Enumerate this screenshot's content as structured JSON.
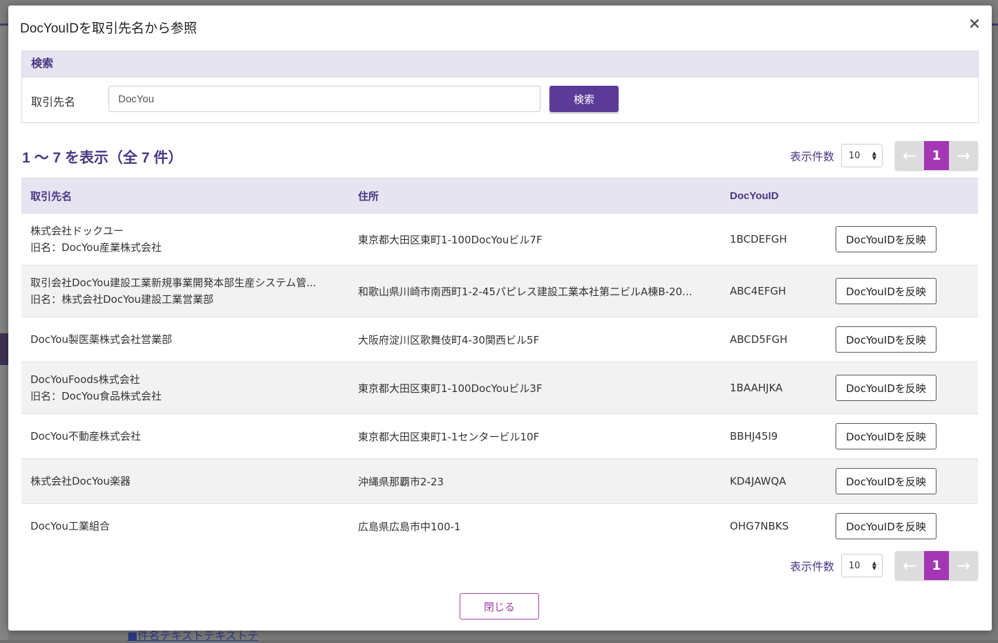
{
  "modal": {
    "title": "DocYouIDを取引先名から参照",
    "close_icon": "×"
  },
  "search": {
    "heading": "検索",
    "label": "取引先名",
    "value": "DocYou",
    "button": "検索"
  },
  "results": {
    "count_text": "1 〜 7 を表示（全 7 件）",
    "per_page_label": "表示件数",
    "per_page_value": "10",
    "current_page": "1"
  },
  "table": {
    "columns": [
      "取引先名",
      "住所",
      "DocYouID",
      ""
    ],
    "action_label": "DocYouIDを反映",
    "rows": [
      {
        "name": "株式会社ドックユー",
        "old_name": "旧名：DocYou産業株式会社",
        "address": "東京都大田区東町1-100DocYouビル7F",
        "id": "1BCDEFGH"
      },
      {
        "name": "取引会社DocYou建設工業新規事業開発本部生産システム管...",
        "old_name": "旧名：株式会社DocYou建設工業営業部",
        "address": "和歌山県川崎市南西町1-2-45パピレス建設工業本社第二ビルA棟B-20...",
        "id": "ABC4EFGH"
      },
      {
        "name": "DocYou製医薬株式会社営業部",
        "old_name": "",
        "address": "大阪府淀川区歌舞伎町4-30関西ビル5F",
        "id": "ABCD5FGH"
      },
      {
        "name": "DocYouFoods株式会社",
        "old_name": "旧名：DocYou食品株式会社",
        "address": "東京都大田区東町1-100DocYouビル3F",
        "id": "1BAAHJKA"
      },
      {
        "name": "DocYou不動産株式会社",
        "old_name": "",
        "address": "東京都大田区東町1-1センタービル10F",
        "id": "BBHJ45I9"
      },
      {
        "name": "株式会社DocYou楽器",
        "old_name": "",
        "address": "沖縄県那覇市2-23",
        "id": "KD4JAWQA"
      },
      {
        "name": "DocYou工業組合",
        "old_name": "",
        "address": "広島県広島市中100-1",
        "id": "OHG7NBKS"
      }
    ]
  },
  "footer": {
    "close_button": "閉じる"
  },
  "background": {
    "link_text": "■件名テキストテキストテ"
  },
  "colors": {
    "accent": "#5b3b97",
    "page_active": "#a437b3",
    "header_bg": "#e6e4f0",
    "heading_text": "#4a3683"
  },
  "icons": [
    "close-icon",
    "arrow-left-icon",
    "arrow-right-icon",
    "sort-arrows-icon"
  ]
}
